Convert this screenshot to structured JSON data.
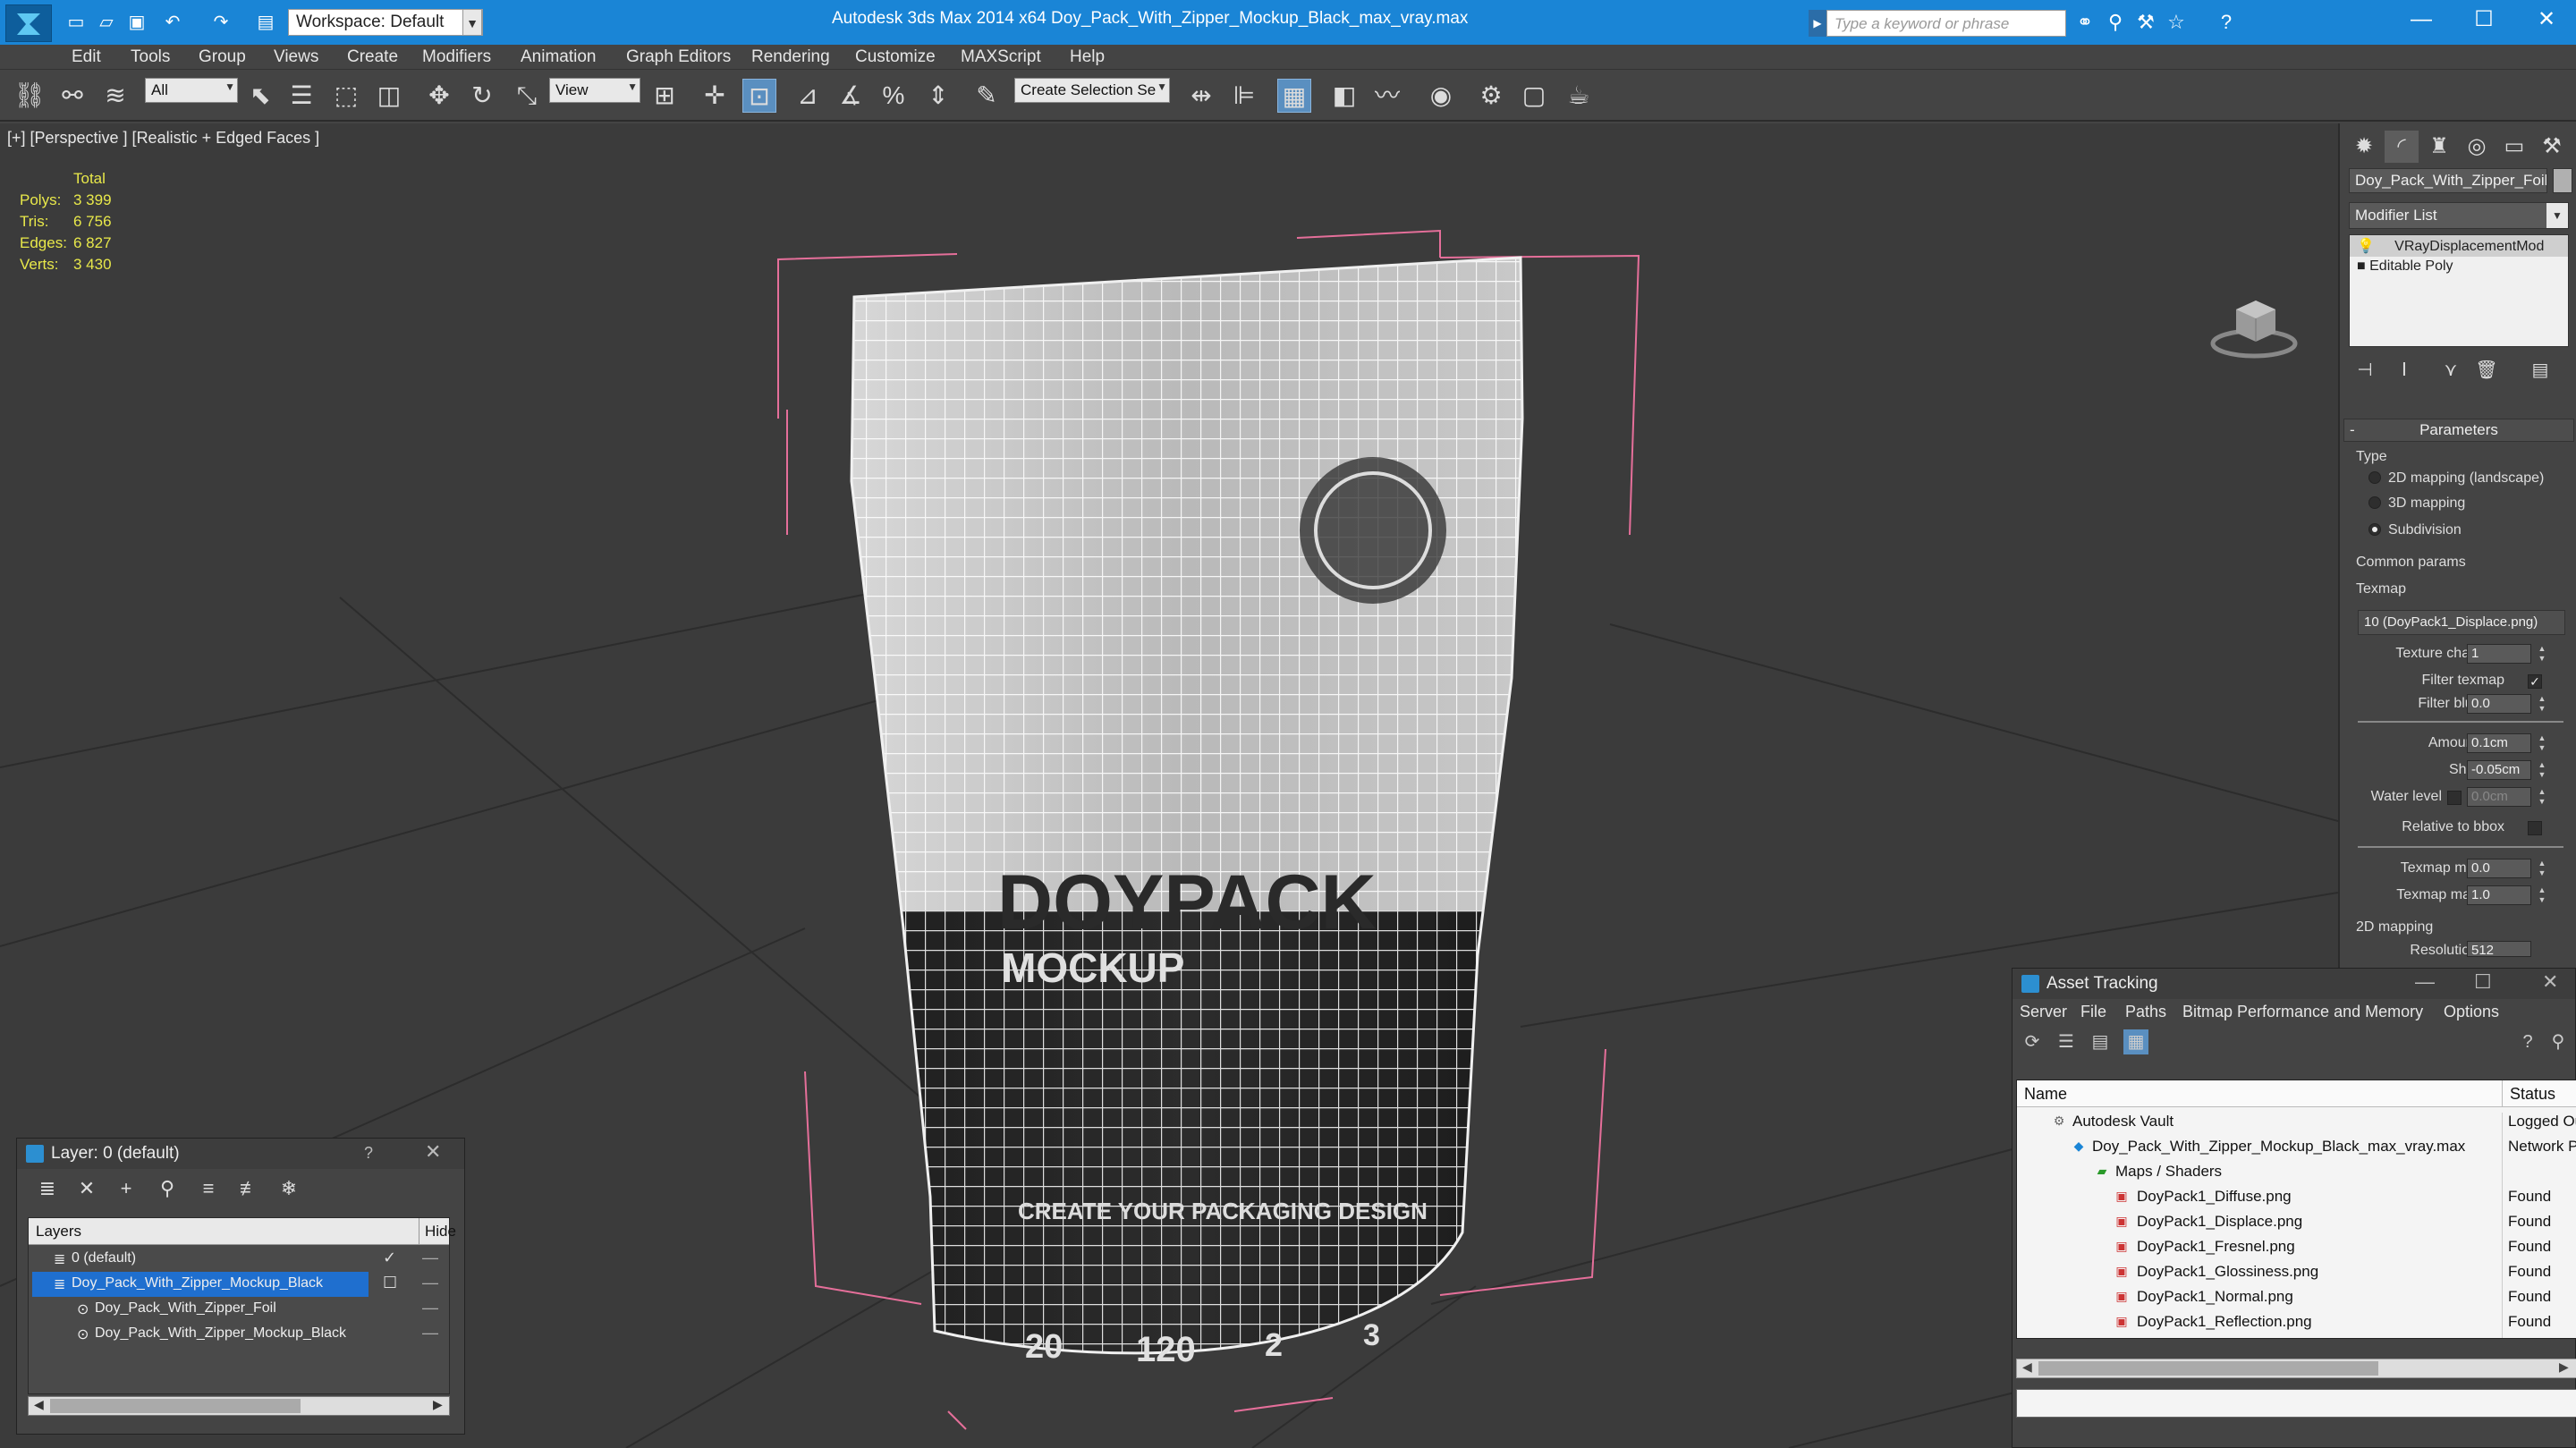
{
  "titlebar": {
    "workspace_label": "Workspace: Default",
    "app_title": "Autodesk 3ds Max  2014 x64       Doy_Pack_With_Zipper_Mockup_Black_max_vray.max",
    "search_placeholder": "Type a keyword or phrase"
  },
  "menu": [
    "Edit",
    "Tools",
    "Group",
    "Views",
    "Create",
    "Modifiers",
    "Animation",
    "Graph Editors",
    "Rendering",
    "Customize",
    "MAXScript",
    "Help"
  ],
  "toolbar": {
    "filter_combo": "All",
    "ref_coord_combo": "View",
    "selection_set_combo": "Create Selection Se"
  },
  "viewport": {
    "label": "[+] [Perspective ] [Realistic + Edged Faces ]",
    "stats": {
      "header": "Total",
      "rows": [
        {
          "k": "Polys:",
          "v": "3 399"
        },
        {
          "k": "Tris:",
          "v": "6 756"
        },
        {
          "k": "Edges:",
          "v": "6 827"
        },
        {
          "k": "Verts:",
          "v": "3 430"
        }
      ]
    }
  },
  "command_panel": {
    "object_name": "Doy_Pack_With_Zipper_Foil",
    "modifier_list": "Modifier List",
    "stack": [
      "VRayDisplacementMod",
      "Editable Poly"
    ],
    "parameters_title": "Parameters",
    "type_group": "Type",
    "type_options": [
      "2D mapping (landscape)",
      "3D mapping",
      "Subdivision"
    ],
    "common_params": "Common params",
    "texmap_label": "Texmap",
    "texmap_value": "10 (DoyPack1_Displace.png)",
    "texture_chan_label": "Texture chan",
    "texture_chan_value": "1",
    "filter_texmap_label": "Filter texmap",
    "filter_blur_label": "Filter blur",
    "filter_blur_value": "0.0",
    "amount_label": "Amount",
    "amount_value": "0.1cm",
    "shift_label": "Shift",
    "shift_value": "-0.05cm",
    "water_level_label": "Water level",
    "water_level_value": "0.0cm",
    "relative_bbox_label": "Relative to bbox",
    "texmap_min_label": "Texmap min",
    "texmap_min_value": "0.0",
    "texmap_max_label": "Texmap max",
    "texmap_max_value": "1.0",
    "mapping_2d": "2D mapping",
    "resolution_label": "Resolution",
    "resolution_value": "512"
  },
  "asset_tracking": {
    "title": "Asset Tracking",
    "menu": [
      "Server",
      "File",
      "Paths",
      "Bitmap Performance and Memory",
      "Options"
    ],
    "col_name": "Name",
    "col_status": "Status",
    "rows": [
      {
        "name": "Autodesk Vault",
        "status": "Logged Ou"
      },
      {
        "name": "Doy_Pack_With_Zipper_Mockup_Black_max_vray.max",
        "status": "Network P"
      },
      {
        "name": "Maps / Shaders",
        "status": ""
      },
      {
        "name": "DoyPack1_Diffuse.png",
        "status": "Found"
      },
      {
        "name": "DoyPack1_Displace.png",
        "status": "Found"
      },
      {
        "name": "DoyPack1_Fresnel.png",
        "status": "Found"
      },
      {
        "name": "DoyPack1_Glossiness.png",
        "status": "Found"
      },
      {
        "name": "DoyPack1_Normal.png",
        "status": "Found"
      },
      {
        "name": "DoyPack1_Reflection.png",
        "status": "Found"
      }
    ]
  },
  "layer_window": {
    "title": "Layer: 0 (default)",
    "help": "?",
    "col_layers": "Layers",
    "col_hide": "Hide",
    "rows": [
      {
        "name": "0 (default)"
      },
      {
        "name": "Doy_Pack_With_Zipper_Mockup_Black"
      },
      {
        "name": "Doy_Pack_With_Zipper_Foil"
      },
      {
        "name": "Doy_Pack_With_Zipper_Mockup_Black"
      }
    ]
  },
  "package_print": {
    "brand": "DOYPACK",
    "sub": "MOCKUP",
    "tagline": "CREATE YOUR PACKAGING DESIGN",
    "n1": "20",
    "n2": "120",
    "n3": "2",
    "n4": "3"
  },
  "colors": {
    "titlebar": "#1a85d6",
    "ui_bg": "#444444",
    "viewport_bg": "#3b3b3b",
    "stats_text": "#e8e84a",
    "selection": "#1f6fcf"
  }
}
